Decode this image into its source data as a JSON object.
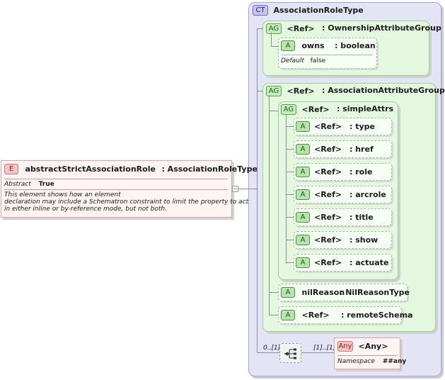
{
  "element": {
    "badge": "E",
    "name": "abstractStrictAssociationRole",
    "type": ": AssociationRoleType",
    "abstract_label": "Abstract",
    "abstract_value": "True",
    "doc_line1": "This element shows how an element",
    "doc_line2": "declaration may include a Schematron constraint to limit the property to act",
    "doc_line3": "in either inline or by-reference mode, but not both.",
    "expander": "−"
  },
  "complex_type": {
    "badge": "CT",
    "name": "AssociationRoleType"
  },
  "ownership_group": {
    "badge": "AG",
    "ref": "<Ref>",
    "name": ": OwnershipAttributeGroup",
    "owns": {
      "badge": "A",
      "name": "owns",
      "type": ": boolean",
      "default_label": "Default",
      "default_value": "false"
    }
  },
  "association_group": {
    "badge": "AG",
    "ref": "<Ref>",
    "name": ": AssociationAttributeGroup",
    "simple_attrs": {
      "badge": "AG",
      "ref": "<Ref>",
      "name": ": simpleAttrs",
      "items": [
        {
          "badge": "A",
          "ref": "<Ref>",
          "name": ": type"
        },
        {
          "badge": "A",
          "ref": "<Ref>",
          "name": ": href"
        },
        {
          "badge": "A",
          "ref": "<Ref>",
          "name": ": role"
        },
        {
          "badge": "A",
          "ref": "<Ref>",
          "name": ": arcrole"
        },
        {
          "badge": "A",
          "ref": "<Ref>",
          "name": ": title"
        },
        {
          "badge": "A",
          "ref": "<Ref>",
          "name": ": show"
        },
        {
          "badge": "A",
          "ref": "<Ref>",
          "name": ": actuate"
        }
      ]
    },
    "nil_reason": {
      "badge": "A",
      "name": "nilReason",
      "type": ": NilReasonType"
    },
    "remote_schema": {
      "badge": "A",
      "ref": "<Ref>",
      "name": ": remoteSchema"
    }
  },
  "sequence": {
    "min_occurs": "0..[1]",
    "max_occurs": "[1]..[1]"
  },
  "any": {
    "badge": "Any",
    "name": "<Any>",
    "namespace_label": "Namespace",
    "namespace_value": "##any"
  }
}
